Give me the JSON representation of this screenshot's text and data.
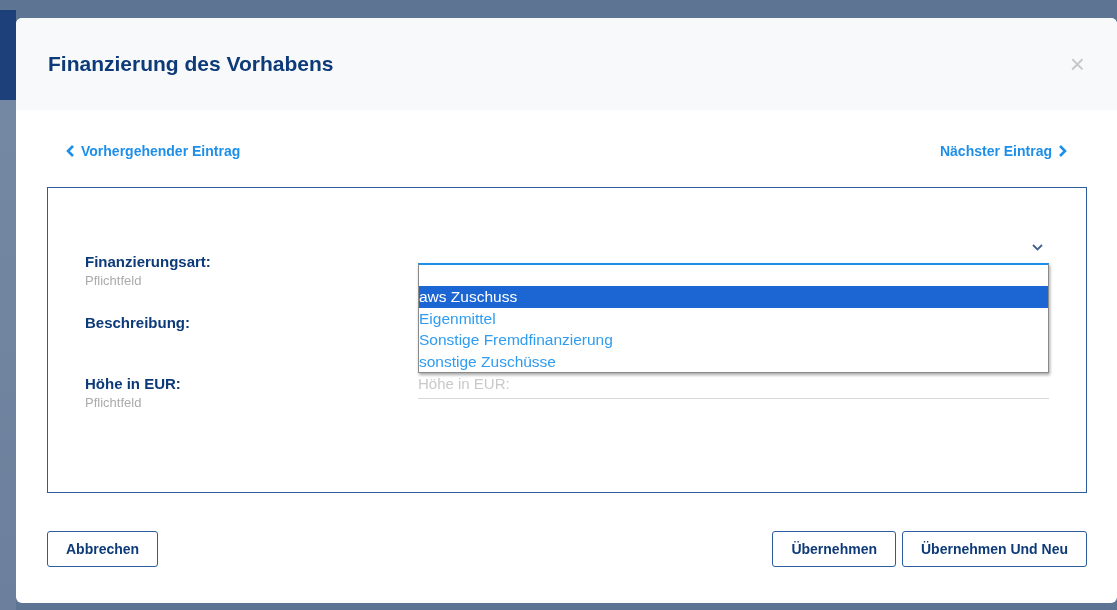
{
  "dialog": {
    "title": "Finanzierung des Vorhabens",
    "close": "×"
  },
  "nav": {
    "previous": "Vorhergehender Eintrag",
    "next": "Nächster Eintrag"
  },
  "fields": [
    {
      "kind": "select",
      "label": "Finanzierungsart:",
      "hint": "Pflichtfeld",
      "expanded": true,
      "options": [
        {
          "label": "aws Zuschuss",
          "selected": true
        },
        {
          "label": "Eigenmittel",
          "selected": false
        },
        {
          "label": "Sonstige Fremdfinanzierung",
          "selected": false
        },
        {
          "label": "sonstige Zuschüsse",
          "selected": false
        }
      ]
    },
    {
      "kind": "text",
      "label": "Beschreibung:"
    },
    {
      "kind": "text",
      "label": "Höhe in EUR:",
      "hint": "Pflichtfeld",
      "placeholder": "Höhe in EUR:"
    }
  ],
  "buttons": [
    {
      "label": "Abbrechen"
    },
    {
      "label": "Übernehmen"
    },
    {
      "label": "Übernehmen Und Neu"
    }
  ]
}
